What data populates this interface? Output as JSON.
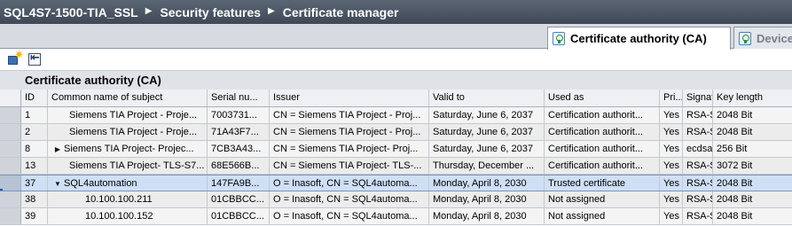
{
  "breadcrumb": {
    "items": [
      "SQL4S7-1500-TIA_SSL",
      "Security features",
      "Certificate manager"
    ],
    "separator": "▶"
  },
  "tabs": [
    {
      "label": "Certificate authority (CA)",
      "active": true
    },
    {
      "label": "Device",
      "active": false
    }
  ],
  "section_title": "Certificate authority (CA)",
  "columns": {
    "id": "ID",
    "common_name": "Common name of subject",
    "serial": "Serial nu...",
    "issuer": "Issuer",
    "valid_to": "Valid to",
    "used_as": "Used as",
    "private_key": "Pri...",
    "signature": "Signat...",
    "key_length": "Key length"
  },
  "rows": [
    {
      "id": "1",
      "cn": "Siemens TIA Project - Proje...",
      "serial": "7003731...",
      "issuer": "CN = Siemens TIA Project - Proj...",
      "valid_to": "Saturday, June 6, 2037",
      "used_as": "Certification authorit...",
      "pri": "Yes",
      "sig": "RSA-S...",
      "key": "2048 Bit",
      "expander": "",
      "level": 1,
      "selected": false
    },
    {
      "id": "2",
      "cn": "Siemens TIA Project - Proje...",
      "serial": "71A43F7...",
      "issuer": "CN = Siemens TIA Project - Proj...",
      "valid_to": "Saturday, June 6, 2037",
      "used_as": "Certification authorit...",
      "pri": "Yes",
      "sig": "RSA-S...",
      "key": "2048 Bit",
      "expander": "",
      "level": 1,
      "selected": false
    },
    {
      "id": "8",
      "cn": "Siemens TIA Project- Projec...",
      "serial": "7CB3A43...",
      "issuer": "CN = Siemens TIA Project- Proj...",
      "valid_to": "Saturday, June 6, 2037",
      "used_as": "Certification authorit...",
      "pri": "Yes",
      "sig": "ecdsa...",
      "key": "256 Bit",
      "expander": "▶",
      "level": 0,
      "selected": false
    },
    {
      "id": "13",
      "cn": "Siemens TIA Project- TLS-S7...",
      "serial": "68E566B...",
      "issuer": "CN = Siemens TIA Project- TLS-...",
      "valid_to": "Thursday, December ...",
      "used_as": "Certification authorit...",
      "pri": "Yes",
      "sig": "RSA-S...",
      "key": "3072 Bit",
      "expander": "",
      "level": 1,
      "selected": false
    },
    {
      "id": "37",
      "cn": "SQL4automation",
      "serial": "147FA9B...",
      "issuer": "O = Inasoft, CN = SQL4automa...",
      "valid_to": "Monday, April 8, 2030",
      "used_as": "Trusted certificate",
      "pri": "Yes",
      "sig": "RSA-S...",
      "key": "2048 Bit",
      "expander": "▼",
      "level": 0,
      "selected": true
    },
    {
      "id": "38",
      "cn": "10.100.100.211",
      "serial": "01CBBCC...",
      "issuer": "O = Inasoft, CN = SQL4automa...",
      "valid_to": "Monday, April 8, 2030",
      "used_as": "Not assigned",
      "pri": "Yes",
      "sig": "RSA-S...",
      "key": "2048 Bit",
      "expander": "",
      "level": 2,
      "selected": false
    },
    {
      "id": "39",
      "cn": "10.100.100.152",
      "serial": "01CBBCC...",
      "issuer": "O = Inasoft, CN = SQL4automa...",
      "valid_to": "Monday, April 8, 2030",
      "used_as": "Not assigned",
      "pri": "Yes",
      "sig": "RSA-S...",
      "key": "2048 Bit",
      "expander": "",
      "level": 2,
      "selected": false
    }
  ]
}
